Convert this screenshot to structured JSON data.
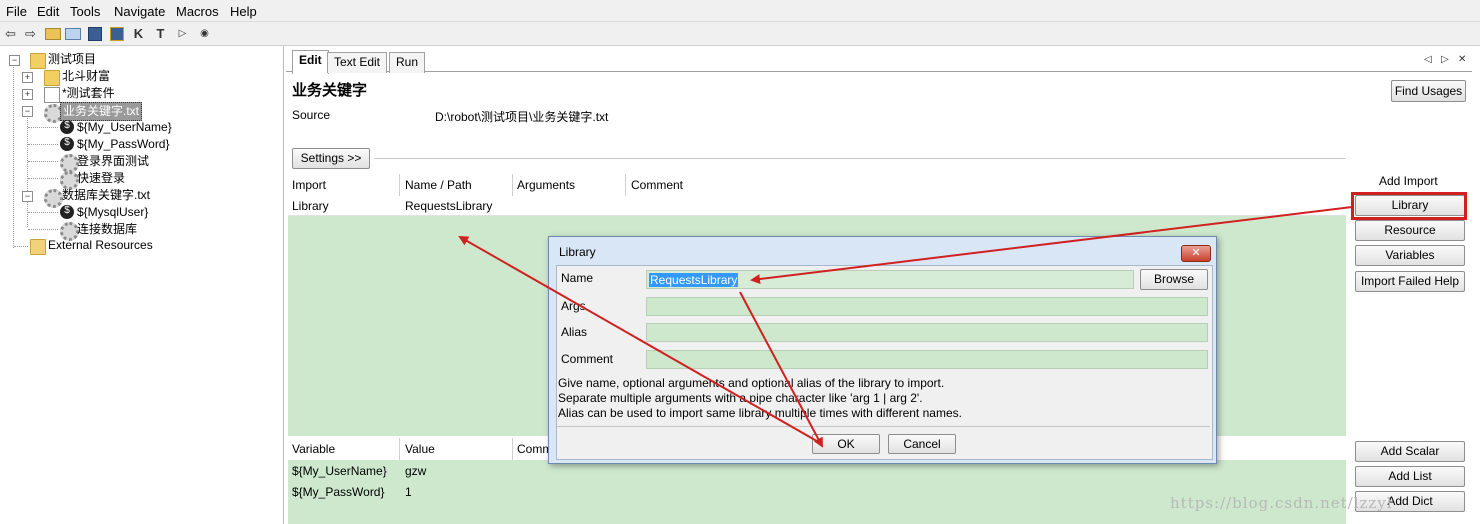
{
  "menu": [
    "File",
    "Edit",
    "Tools",
    "Navigate",
    "Macros",
    "Help"
  ],
  "toolbar": {
    "icons": [
      "back-arrow-icon",
      "forward-arrow-icon",
      "open-folder-icon",
      "folder-icon",
      "save-icon",
      "save-all-icon",
      "keyword-search-icon",
      "test-search-icon",
      "run-icon",
      "stop-icon"
    ],
    "k_label": "K",
    "t_label": "T"
  },
  "tree": {
    "items": [
      {
        "label": "测试项目"
      },
      {
        "label": "北斗财富"
      },
      {
        "label": "*测试套件"
      },
      {
        "label": "业务关键字.txt"
      },
      {
        "label": "${My_UserName}"
      },
      {
        "label": "${My_PassWord}"
      },
      {
        "label": "登录界面测试"
      },
      {
        "label": "快速登录"
      },
      {
        "label": "数据库关键字.txt"
      },
      {
        "label": "${MysqlUser}"
      },
      {
        "label": "连接数据库"
      },
      {
        "label": "External Resources"
      }
    ]
  },
  "tabs": [
    "Edit",
    "Text Edit",
    "Run"
  ],
  "editor": {
    "title": "业务关键字",
    "find_usages": "Find Usages",
    "source_label": "Source",
    "source_value": "D:\\robot\\测试项目\\业务关键字.txt",
    "settings_button": "Settings >>"
  },
  "imports": {
    "columns": [
      "Import",
      "Name / Path",
      "Arguments",
      "Comment"
    ],
    "rows": [
      {
        "type": "Library",
        "name": "RequestsLibrary"
      }
    ]
  },
  "add_import": {
    "label": "Add Import",
    "buttons": [
      "Library",
      "Resource",
      "Variables",
      "Import Failed Help"
    ]
  },
  "variables": {
    "columns": [
      "Variable",
      "Value",
      "Comment"
    ],
    "rows": [
      {
        "name": "${My_UserName}",
        "value": "gzw"
      },
      {
        "name": "${My_PassWord}",
        "value": "1"
      }
    ],
    "buttons": [
      "Add Scalar",
      "Add List",
      "Add Dict"
    ]
  },
  "dialog": {
    "title": "Library",
    "close_glyph": "✕",
    "name_label": "Name",
    "name_value": "RequestsLibrary",
    "browse": "Browse",
    "args_label": "Args",
    "alias_label": "Alias",
    "comment_label": "Comment",
    "help_lines": [
      "Give name, optional arguments and optional alias of the library to import.",
      "Separate multiple arguments with a pipe character like 'arg 1 | arg 2'.",
      "Alias can be used to import same library multiple times with different names."
    ],
    "ok": "OK",
    "cancel": "Cancel"
  },
  "nav_arrows": {
    "left": "◁",
    "right": "▷",
    "close": "✕"
  },
  "watermark": "https://blog.csdn.net/lzzyl"
}
